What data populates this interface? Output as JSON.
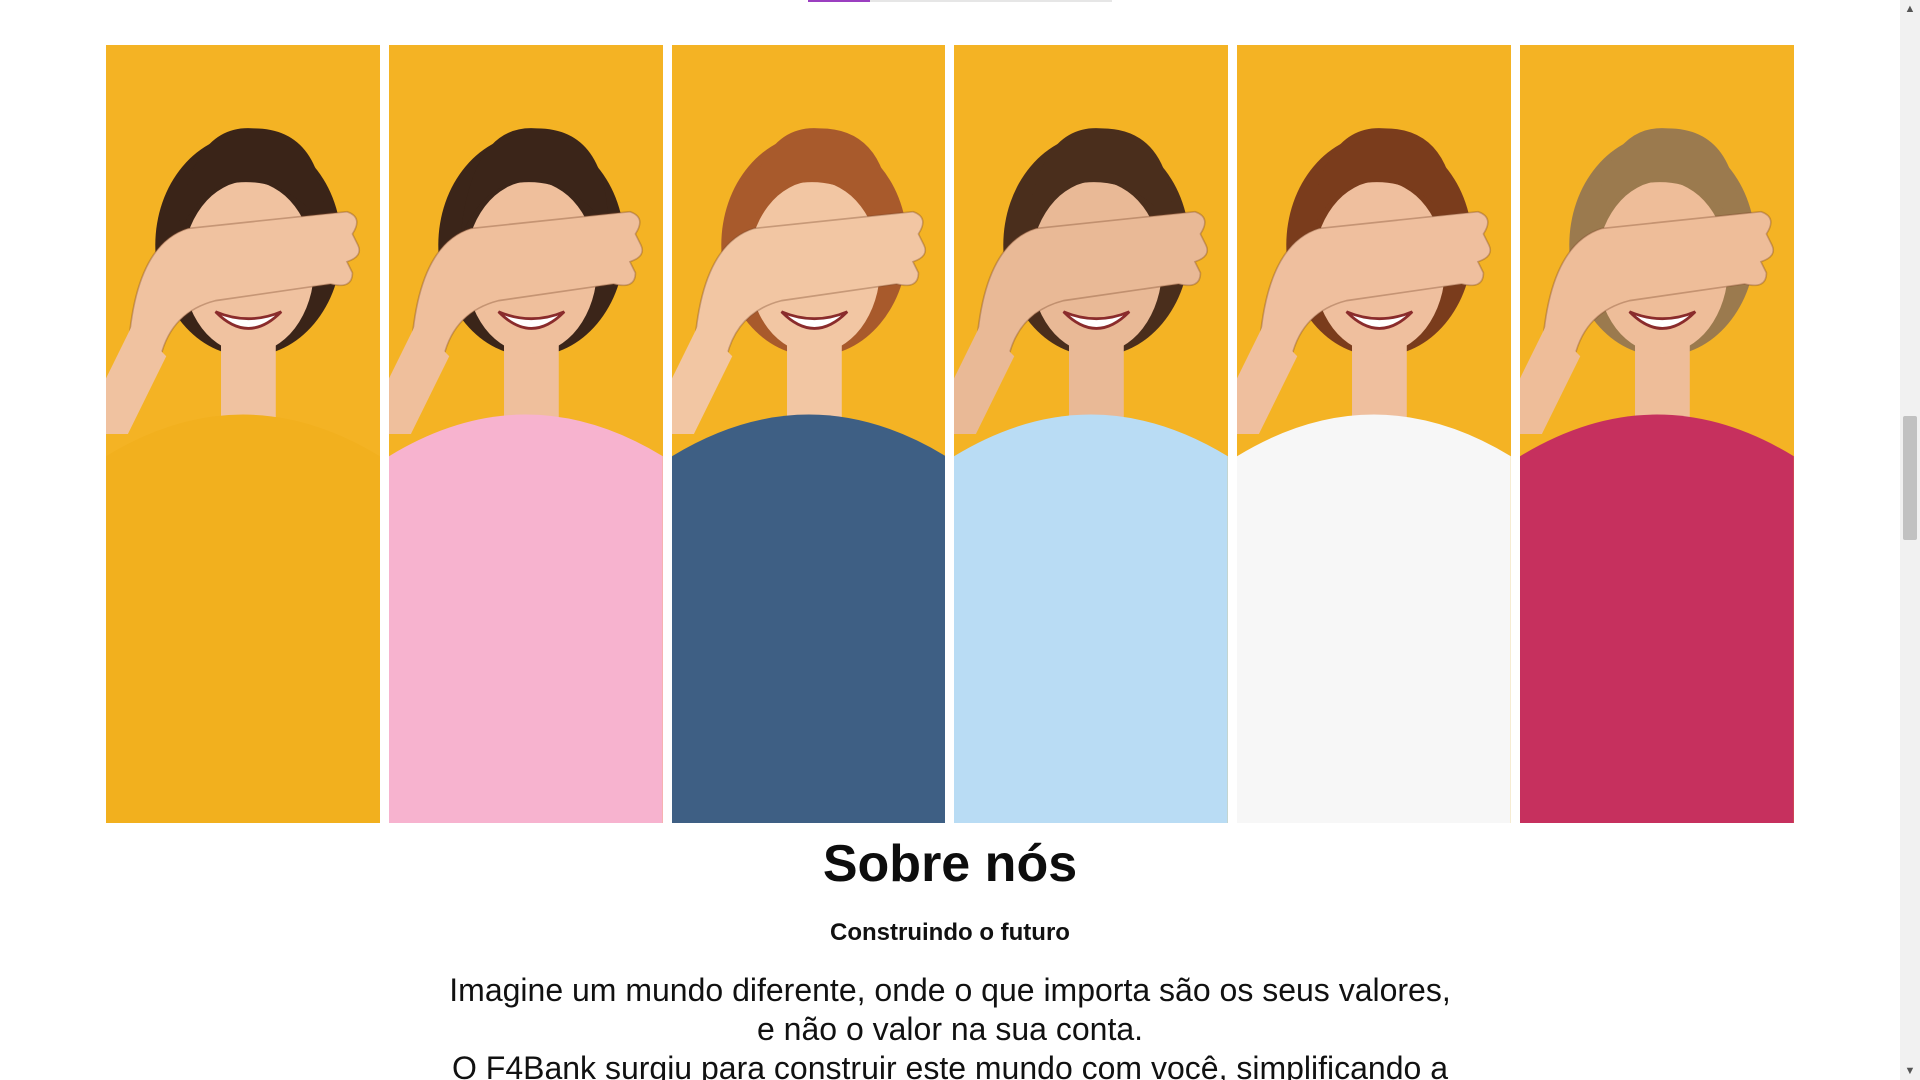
{
  "about": {
    "title": "Sobre nós",
    "subtitle": "Construindo o futuro",
    "description_lines": [
      "Imagine um mundo diferente, onde o que importa são os seus valores,",
      "e não o valor na sua conta.",
      "O F4Bank surgiu para construir este mundo com você, simplificando a"
    ]
  },
  "photos": [
    {
      "shirt": "#f2b01e",
      "hair": "#3a2418",
      "skin": "#f0c2a0"
    },
    {
      "shirt": "#f7b3cf",
      "hair": "#3b2519",
      "skin": "#efbf9c"
    },
    {
      "shirt": "#3e5f84",
      "hair": "#a85a2c",
      "skin": "#f2c6a3"
    },
    {
      "shirt": "#b9dcf4",
      "hair": "#4a2e1c",
      "skin": "#e9b996"
    },
    {
      "shirt": "#f7f7f7",
      "hair": "#7a3c1c",
      "skin": "#efbf9e"
    },
    {
      "shirt": "#c6305e",
      "hair": "#9b7a4e",
      "skin": "#eebd99"
    }
  ],
  "colors": {
    "background": "#f4b324",
    "accent": "#9b3fc0"
  },
  "scrollbar": {
    "up_icon": "▲",
    "down_icon": "▼"
  }
}
